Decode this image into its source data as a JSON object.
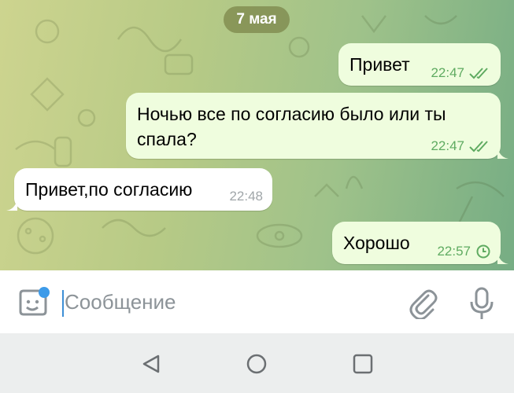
{
  "date_separator": "7 мая",
  "messages": [
    {
      "direction": "outgoing",
      "text": "Привет",
      "time": "22:47",
      "status": "read-double-check-icon"
    },
    {
      "direction": "outgoing",
      "text": "Ночью все по согласию было или ты\nспала?",
      "time": "22:47",
      "status": "read-double-check-icon"
    },
    {
      "direction": "incoming",
      "text": "Привет,по согласию",
      "time": "22:48"
    },
    {
      "direction": "outgoing",
      "text": "Хорошо",
      "time": "22:57",
      "status": "pending-clock-icon"
    }
  ],
  "composer": {
    "placeholder": "Сообщение",
    "left_icon": "sticker-icon",
    "right_icons": [
      "paperclip-icon",
      "microphone-icon"
    ]
  },
  "navbar": {
    "icons": [
      "back-icon",
      "home-icon",
      "recents-icon"
    ]
  },
  "colors": {
    "outgoing_bubble": "#effdde",
    "incoming_bubble": "#ffffff",
    "outgoing_meta": "#5fab61",
    "accent": "#3d8fd6"
  }
}
